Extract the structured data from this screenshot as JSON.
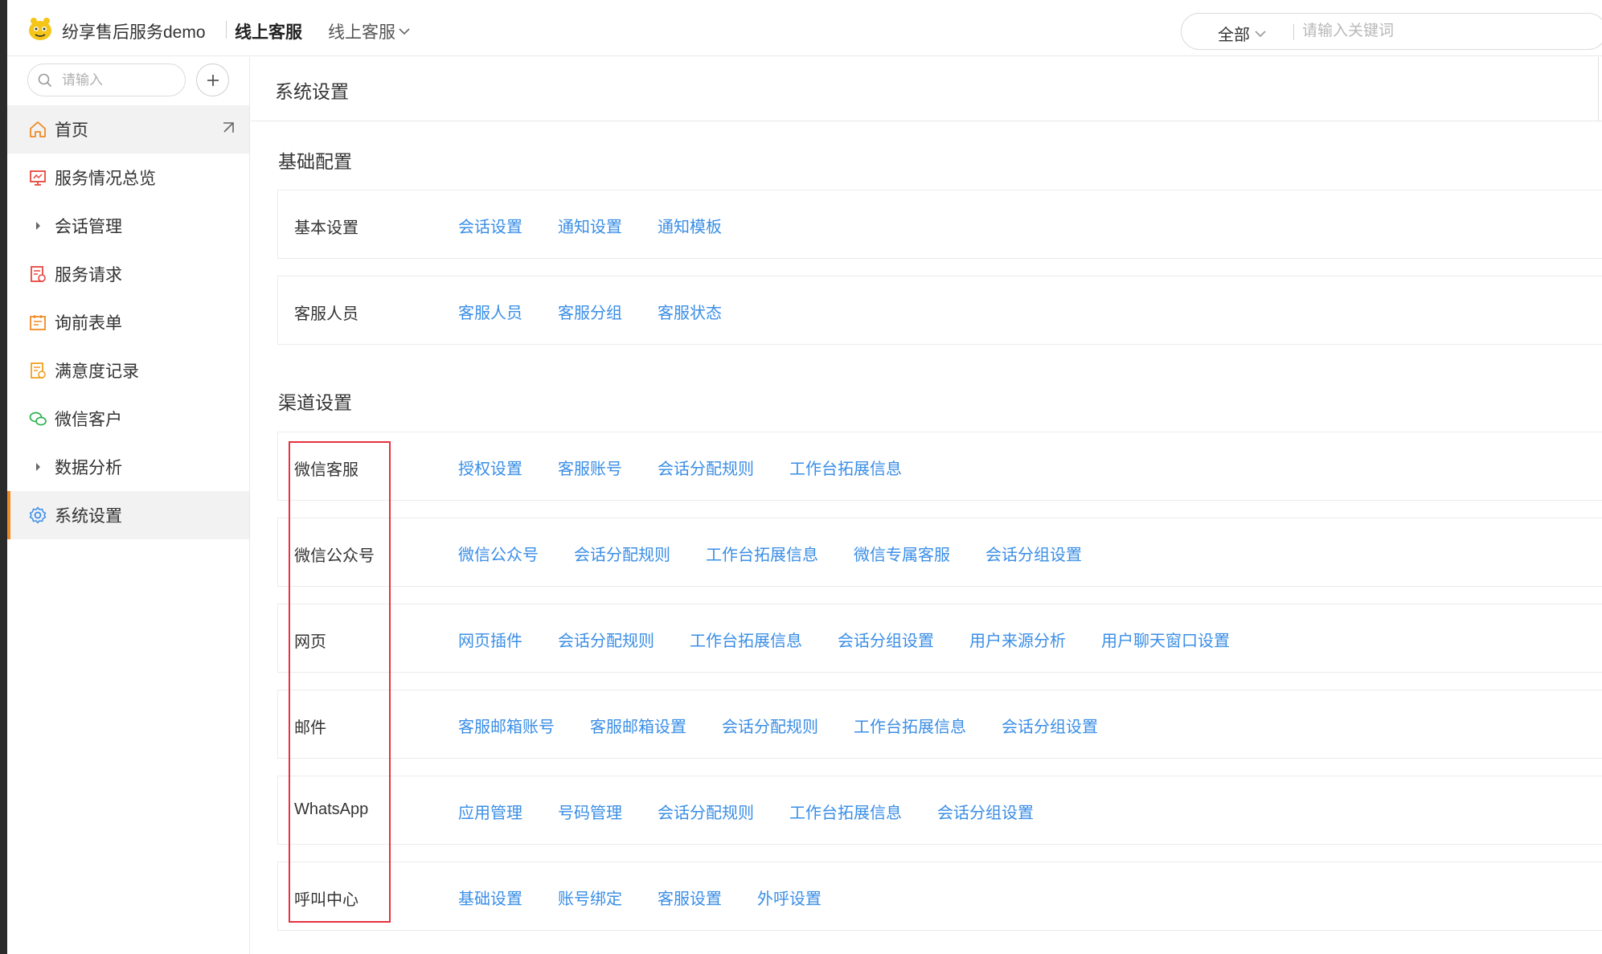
{
  "topbar": {
    "brand": "纷享售后服务demo",
    "product": "线上客服",
    "product_dropdown": "线上客服",
    "search_scope": "全部",
    "search_placeholder": "请输入关键词"
  },
  "sidebar": {
    "search_placeholder": "请输入",
    "items": [
      {
        "label": "首页",
        "icon": "home-icon"
      },
      {
        "label": "服务情况总览",
        "icon": "monitor-icon"
      },
      {
        "label": "会话管理",
        "icon": "caret-right-icon"
      },
      {
        "label": "服务请求",
        "icon": "request-icon"
      },
      {
        "label": "询前表单",
        "icon": "form-icon"
      },
      {
        "label": "满意度记录",
        "icon": "survey-icon"
      },
      {
        "label": "微信客户",
        "icon": "wechat-icon"
      },
      {
        "label": "数据分析",
        "icon": "caret-right-icon"
      },
      {
        "label": "系统设置",
        "icon": "gear-icon"
      }
    ],
    "active": "系统设置",
    "accent_color": "#f08a24"
  },
  "main": {
    "title": "系统设置",
    "basic_section": {
      "title": "基础配置",
      "rows": [
        {
          "label": "基本设置",
          "links": [
            "会话设置",
            "通知设置",
            "通知模板"
          ]
        },
        {
          "label": "客服人员",
          "links": [
            "客服人员",
            "客服分组",
            "客服状态"
          ]
        }
      ]
    },
    "channel_section": {
      "title": "渠道设置",
      "rows": [
        {
          "label": "微信客服",
          "links": [
            "授权设置",
            "客服账号",
            "会话分配规则",
            "工作台拓展信息"
          ]
        },
        {
          "label": "微信公众号",
          "links": [
            "微信公众号",
            "会话分配规则",
            "工作台拓展信息",
            "微信专属客服",
            "会话分组设置"
          ]
        },
        {
          "label": "网页",
          "links": [
            "网页插件",
            "会话分配规则",
            "工作台拓展信息",
            "会话分组设置",
            "用户来源分析",
            "用户聊天窗口设置"
          ]
        },
        {
          "label": "邮件",
          "links": [
            "客服邮箱账号",
            "客服邮箱设置",
            "会话分配规则",
            "工作台拓展信息",
            "会话分组设置"
          ]
        },
        {
          "label": "WhatsApp",
          "links": [
            "应用管理",
            "号码管理",
            "会话分配规则",
            "工作台拓展信息",
            "会话分组设置"
          ]
        },
        {
          "label": "呼叫中心",
          "links": [
            "基础设置",
            "账号绑定",
            "客服设置",
            "外呼设置"
          ]
        }
      ]
    },
    "link_color": "#3a8ee6",
    "highlight_color": "#e5323e"
  }
}
